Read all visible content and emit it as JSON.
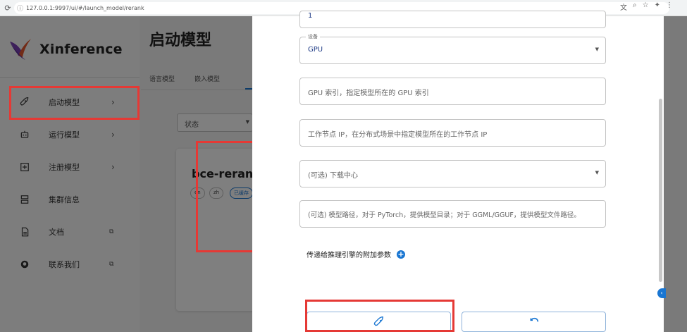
{
  "browser": {
    "url": "127.0.0.1:9997/ui/#/launch_model/rerank"
  },
  "sidebar": {
    "brand": "Xinference",
    "items": [
      {
        "label": "启动模型",
        "icon": "rocket-icon"
      },
      {
        "label": "运行模型",
        "icon": "robot-icon"
      },
      {
        "label": "注册模型",
        "icon": "add-box-icon"
      },
      {
        "label": "集群信息",
        "icon": "dns-icon"
      },
      {
        "label": "文档",
        "icon": "document-icon"
      },
      {
        "label": "联系我们",
        "icon": "github-icon"
      }
    ]
  },
  "main": {
    "title": "启动模型",
    "tabs": [
      "语言模型",
      "嵌入模型"
    ],
    "status_filter": "状态",
    "card": {
      "title": "bce-reranke",
      "chips": [
        "en",
        "zh",
        "已缓存"
      ]
    }
  },
  "drawer": {
    "replica_value": "1",
    "device": {
      "legend": "设备",
      "value": "GPU"
    },
    "gpu_index_placeholder": "GPU 索引，指定模型所在的 GPU 索引",
    "worker_ip_placeholder": "工作节点 IP，在分布式场景中指定模型所在的工作节点 IP",
    "download_hub_placeholder": "(可选) 下载中心",
    "model_path_placeholder": "(可选) 模型路径，对于 PyTorch，提供模型目录；对于 GGML/GGUF，提供模型文件路径。",
    "extra_params_label": "传递给推理引擎的附加参数"
  },
  "colors": {
    "accent": "#1976d2",
    "highlight": "#e53935"
  }
}
